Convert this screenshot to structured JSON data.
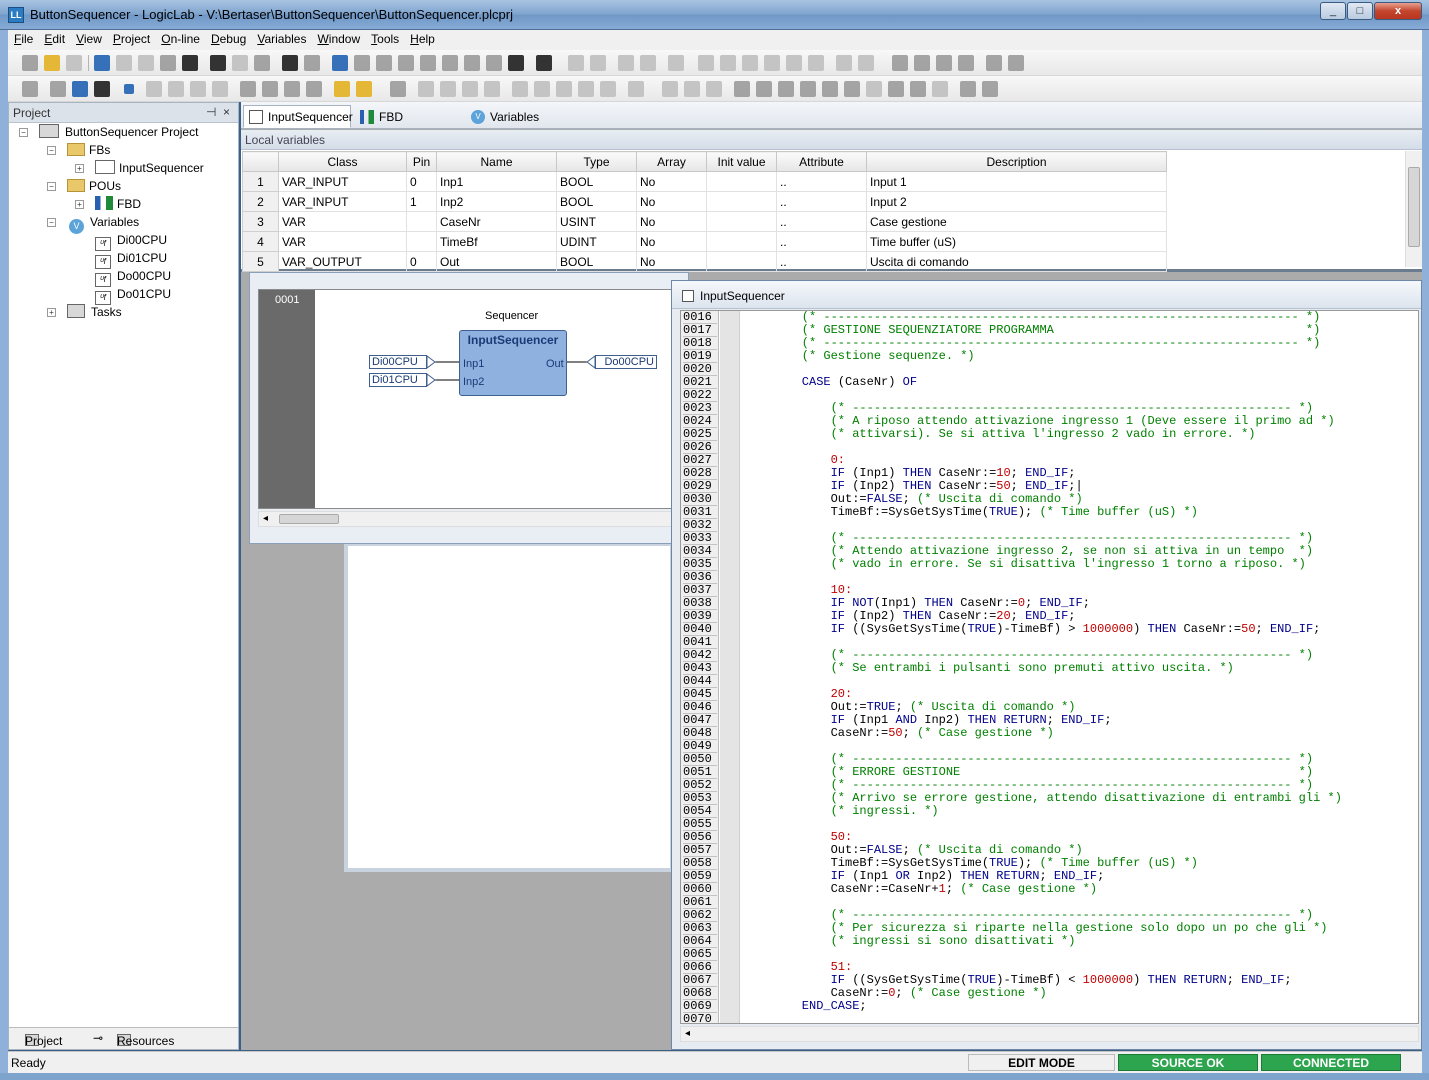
{
  "window": {
    "title": "ButtonSequencer - LogicLab - V:\\Bertaser\\ButtonSequencer\\ButtonSequencer.plcprj",
    "minimize": "_",
    "maximize": "□",
    "close": "x"
  },
  "menu": [
    "File",
    "Edit",
    "View",
    "Project",
    "On-line",
    "Debug",
    "Variables",
    "Window",
    "Tools",
    "Help"
  ],
  "project_panel": {
    "title": "Project",
    "pin": "⊣",
    "close": "×",
    "tree": {
      "root": "ButtonSequencer Project",
      "fbs": "FBs",
      "fb_item": "InputSequencer",
      "pous": "POUs",
      "pou_item": "FBD",
      "variables": "Variables",
      "vars": [
        "Di00CPU",
        "Di01CPU",
        "Do00CPU",
        "Do01CPU"
      ],
      "tasks": "Tasks"
    },
    "bottom_tabs": [
      "Project",
      "Resources"
    ]
  },
  "doc_tabs": [
    "InputSequencer",
    "FBD",
    "Variables"
  ],
  "local_variables": {
    "title": "Local variables",
    "columns": [
      "Class",
      "Pin",
      "Name",
      "Type",
      "Array",
      "Init value",
      "Attribute",
      "Description"
    ],
    "rows": [
      {
        "n": "1",
        "class": "VAR_INPUT",
        "pin": "0",
        "name": "Inp1",
        "type": "BOOL",
        "array": "No",
        "init": "",
        "attr": "..",
        "desc": "Input 1"
      },
      {
        "n": "2",
        "class": "VAR_INPUT",
        "pin": "1",
        "name": "Inp2",
        "type": "BOOL",
        "array": "No",
        "init": "",
        "attr": "..",
        "desc": "Input 2"
      },
      {
        "n": "3",
        "class": "VAR",
        "pin": "",
        "name": "CaseNr",
        "type": "USINT",
        "array": "No",
        "init": "",
        "attr": "..",
        "desc": "Case gestione"
      },
      {
        "n": "4",
        "class": "VAR",
        "pin": "",
        "name": "TimeBf",
        "type": "UDINT",
        "array": "No",
        "init": "",
        "attr": "..",
        "desc": "Time buffer (uS)"
      },
      {
        "n": "5",
        "class": "VAR_OUTPUT",
        "pin": "0",
        "name": "Out",
        "type": "BOOL",
        "array": "No",
        "init": "",
        "attr": "..",
        "desc": "Uscita di comando"
      }
    ]
  },
  "fbd": {
    "title": "FBD",
    "network": "0001",
    "instance": "Sequencer",
    "block": "InputSequencer",
    "inputs": [
      "Inp1",
      "Inp2"
    ],
    "output": "Out",
    "in_vars": [
      "Di00CPU",
      "Di01CPU"
    ],
    "out_var": "Do00CPU"
  },
  "code_window": {
    "title": "InputSequencer",
    "first_line": 16,
    "lines": [
      [
        [
          "cm",
          "    (* ------------------------------------------------------------------ *)"
        ]
      ],
      [
        [
          "cm",
          "    (* GESTIONE SEQUENZIATORE PROGRAMMA                                   *)"
        ]
      ],
      [
        [
          "cm",
          "    (* ------------------------------------------------------------------ *)"
        ]
      ],
      [
        [
          "cm",
          "    (* Gestione sequenze. *)"
        ]
      ],
      [
        [
          "tx",
          ""
        ]
      ],
      [
        [
          "kw",
          "    CASE "
        ],
        [
          "tx",
          "(CaseNr) "
        ],
        [
          "kw",
          "OF"
        ]
      ],
      [
        [
          "tx",
          ""
        ]
      ],
      [
        [
          "cm",
          "        (* ------------------------------------------------------------- *)"
        ]
      ],
      [
        [
          "cm",
          "        (* A riposo attendo attivazione ingresso 1 (Deve essere il primo ad *)"
        ]
      ],
      [
        [
          "cm",
          "        (* attivarsi). Se si attiva l'ingresso 2 vado in errore. *)"
        ]
      ],
      [
        [
          "tx",
          ""
        ]
      ],
      [
        [
          "nm",
          "        0:"
        ]
      ],
      [
        [
          "kw",
          "        IF "
        ],
        [
          "tx",
          "(Inp1) "
        ],
        [
          "kw",
          "THEN "
        ],
        [
          "tx",
          "CaseNr:="
        ],
        [
          "nm",
          "10"
        ],
        [
          "tx",
          "; "
        ],
        [
          "kw",
          "END_IF"
        ],
        [
          "tx",
          ";"
        ]
      ],
      [
        [
          "kw",
          "        IF "
        ],
        [
          "tx",
          "(Inp2) "
        ],
        [
          "kw",
          "THEN "
        ],
        [
          "tx",
          "CaseNr:="
        ],
        [
          "nm",
          "50"
        ],
        [
          "tx",
          "; "
        ],
        [
          "kw",
          "END_IF"
        ],
        [
          "tx",
          ";|"
        ]
      ],
      [
        [
          "tx",
          "        Out:="
        ],
        [
          "kw",
          "FALSE"
        ],
        [
          "tx",
          "; "
        ],
        [
          "cm",
          "(* Uscita di comando *)"
        ]
      ],
      [
        [
          "tx",
          "        TimeBf:=SysGetSysTime("
        ],
        [
          "kw",
          "TRUE"
        ],
        [
          "tx",
          "); "
        ],
        [
          "cm",
          "(* Time buffer (uS) *)"
        ]
      ],
      [
        [
          "tx",
          ""
        ]
      ],
      [
        [
          "cm",
          "        (* ------------------------------------------------------------- *)"
        ]
      ],
      [
        [
          "cm",
          "        (* Attendo attivazione ingresso 2, se non si attiva in un tempo  *)"
        ]
      ],
      [
        [
          "cm",
          "        (* vado in errore. Se si disattiva l'ingresso 1 torno a riposo. *)"
        ]
      ],
      [
        [
          "tx",
          ""
        ]
      ],
      [
        [
          "nm",
          "        10:"
        ]
      ],
      [
        [
          "kw",
          "        IF NOT"
        ],
        [
          "tx",
          "(Inp1) "
        ],
        [
          "kw",
          "THEN "
        ],
        [
          "tx",
          "CaseNr:="
        ],
        [
          "nm",
          "0"
        ],
        [
          "tx",
          "; "
        ],
        [
          "kw",
          "END_IF"
        ],
        [
          "tx",
          ";"
        ]
      ],
      [
        [
          "kw",
          "        IF "
        ],
        [
          "tx",
          "(Inp2) "
        ],
        [
          "kw",
          "THEN "
        ],
        [
          "tx",
          "CaseNr:="
        ],
        [
          "nm",
          "20"
        ],
        [
          "tx",
          "; "
        ],
        [
          "kw",
          "END_IF"
        ],
        [
          "tx",
          ";"
        ]
      ],
      [
        [
          "kw",
          "        IF "
        ],
        [
          "tx",
          "((SysGetSysTime("
        ],
        [
          "kw",
          "TRUE"
        ],
        [
          "tx",
          ")-TimeBf) > "
        ],
        [
          "nm",
          "1000000"
        ],
        [
          "tx",
          ") "
        ],
        [
          "kw",
          "THEN "
        ],
        [
          "tx",
          "CaseNr:="
        ],
        [
          "nm",
          "50"
        ],
        [
          "tx",
          "; "
        ],
        [
          "kw",
          "END_IF"
        ],
        [
          "tx",
          ";"
        ]
      ],
      [
        [
          "tx",
          ""
        ]
      ],
      [
        [
          "cm",
          "        (* ------------------------------------------------------------- *)"
        ]
      ],
      [
        [
          "cm",
          "        (* Se entrambi i pulsanti sono premuti attivo uscita. *)"
        ]
      ],
      [
        [
          "tx",
          ""
        ]
      ],
      [
        [
          "nm",
          "        20:"
        ]
      ],
      [
        [
          "tx",
          "        Out:="
        ],
        [
          "kw",
          "TRUE"
        ],
        [
          "tx",
          "; "
        ],
        [
          "cm",
          "(* Uscita di comando *)"
        ]
      ],
      [
        [
          "kw",
          "        IF "
        ],
        [
          "tx",
          "(Inp1 "
        ],
        [
          "kw",
          "AND "
        ],
        [
          "tx",
          "Inp2) "
        ],
        [
          "kw",
          "THEN RETURN"
        ],
        [
          "tx",
          "; "
        ],
        [
          "kw",
          "END_IF"
        ],
        [
          "tx",
          ";"
        ]
      ],
      [
        [
          "tx",
          "        CaseNr:="
        ],
        [
          "nm",
          "50"
        ],
        [
          "tx",
          "; "
        ],
        [
          "cm",
          "(* Case gestione *)"
        ]
      ],
      [
        [
          "tx",
          ""
        ]
      ],
      [
        [
          "cm",
          "        (* ------------------------------------------------------------- *)"
        ]
      ],
      [
        [
          "cm",
          "        (* ERRORE GESTIONE                                               *)"
        ]
      ],
      [
        [
          "cm",
          "        (* ------------------------------------------------------------- *)"
        ]
      ],
      [
        [
          "cm",
          "        (* Arrivo se errore gestione, attendo disattivazione di entrambi gli *)"
        ]
      ],
      [
        [
          "cm",
          "        (* ingressi. *)"
        ]
      ],
      [
        [
          "tx",
          ""
        ]
      ],
      [
        [
          "nm",
          "        50:"
        ]
      ],
      [
        [
          "tx",
          "        Out:="
        ],
        [
          "kw",
          "FALSE"
        ],
        [
          "tx",
          "; "
        ],
        [
          "cm",
          "(* Uscita di comando *)"
        ]
      ],
      [
        [
          "tx",
          "        TimeBf:=SysGetSysTime("
        ],
        [
          "kw",
          "TRUE"
        ],
        [
          "tx",
          "); "
        ],
        [
          "cm",
          "(* Time buffer (uS) *)"
        ]
      ],
      [
        [
          "kw",
          "        IF "
        ],
        [
          "tx",
          "(Inp1 "
        ],
        [
          "kw",
          "OR "
        ],
        [
          "tx",
          "Inp2) "
        ],
        [
          "kw",
          "THEN RETURN"
        ],
        [
          "tx",
          "; "
        ],
        [
          "kw",
          "END_IF"
        ],
        [
          "tx",
          ";"
        ]
      ],
      [
        [
          "tx",
          "        CaseNr:=CaseNr+"
        ],
        [
          "nm",
          "1"
        ],
        [
          "tx",
          "; "
        ],
        [
          "cm",
          "(* Case gestione *)"
        ]
      ],
      [
        [
          "tx",
          ""
        ]
      ],
      [
        [
          "cm",
          "        (* ------------------------------------------------------------- *)"
        ]
      ],
      [
        [
          "cm",
          "        (* Per sicurezza si riparte nella gestione solo dopo un po che gli *)"
        ]
      ],
      [
        [
          "cm",
          "        (* ingressi si sono disattivati *)"
        ]
      ],
      [
        [
          "tx",
          ""
        ]
      ],
      [
        [
          "nm",
          "        51:"
        ]
      ],
      [
        [
          "kw",
          "        IF "
        ],
        [
          "tx",
          "((SysGetSysTime("
        ],
        [
          "kw",
          "TRUE"
        ],
        [
          "tx",
          ")-TimeBf) < "
        ],
        [
          "nm",
          "1000000"
        ],
        [
          "tx",
          ") "
        ],
        [
          "kw",
          "THEN RETURN"
        ],
        [
          "tx",
          "; "
        ],
        [
          "kw",
          "END_IF"
        ],
        [
          "tx",
          ";"
        ]
      ],
      [
        [
          "tx",
          "        CaseNr:="
        ],
        [
          "nm",
          "0"
        ],
        [
          "tx",
          "; "
        ],
        [
          "cm",
          "(* Case gestione *)"
        ]
      ],
      [
        [
          "kw",
          "    END_CASE"
        ],
        [
          "tx",
          ";"
        ]
      ],
      [
        [
          "tx",
          ""
        ]
      ]
    ]
  },
  "statusbar": {
    "ready": "Ready",
    "mode": "EDIT MODE",
    "source": "SOURCE OK",
    "connection": "CONNECTED"
  },
  "colors": {
    "comment": "#008000",
    "keyword": "#00008b",
    "number": "#c00000",
    "status_ok": "#2da44e",
    "fb_block": "#8fb1e0"
  }
}
